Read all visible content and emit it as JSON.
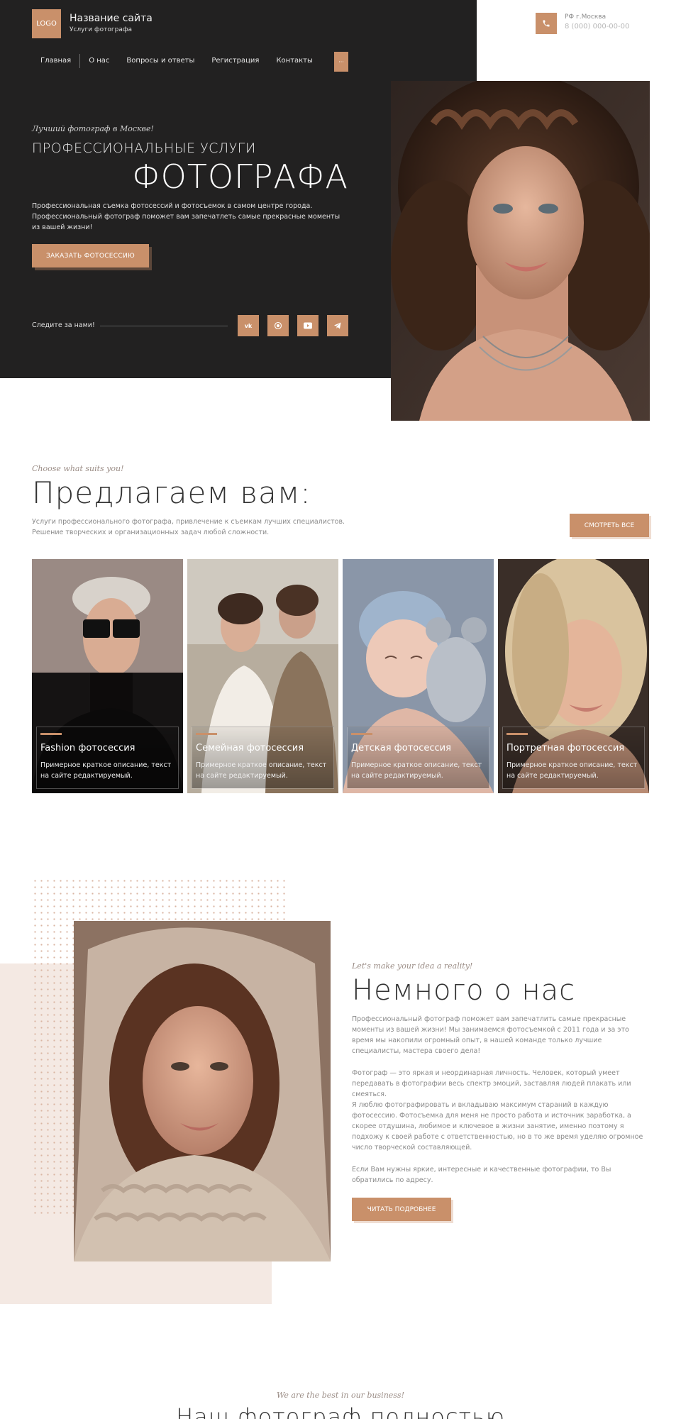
{
  "header": {
    "logo": "LOGO",
    "site_name": "Название сайта",
    "site_subtitle": "Услуги фотографа",
    "nav": [
      "Главная",
      "О нас",
      "Вопросы и ответы",
      "Регистрация",
      "Контакты"
    ],
    "contact_city": "РФ г.Москва",
    "contact_phone": "8 (000) 000-00-00"
  },
  "hero": {
    "tagline": "Лучший фотограф в Москве!",
    "title_line1": "ПРОФЕССИОНАЛЬНЫЕ УСЛУГИ",
    "title_line2": "ФОТОГРАФА",
    "description": "Профессиональная съемка фотосессий и фотосъемок в самом центре города. Профессиональный фотограф поможет вам запечатлеть самые прекрасные моменты из вашей жизни!",
    "cta": "ЗАКАЗАТЬ ФОТОСЕССИЮ",
    "follow_label": "Следите за нами!",
    "social": [
      "vk-icon",
      "whatsapp-icon",
      "youtube-icon",
      "telegram-icon"
    ]
  },
  "offers": {
    "tagline": "Choose what suits you!",
    "title": "Предлагаем вам:",
    "description": "Услуги профессионального фотографа, привлечение к съемкам лучших специалистов. Решение творческих и организационных задач любой сложности.",
    "view_all": "СМОТРЕТЬ ВСЕ",
    "cards": [
      {
        "title": "Fashion фотосессия",
        "desc": "Примерное краткое описание, текст на сайте редактируемый."
      },
      {
        "title": "Семейная фотосессия",
        "desc": "Примерное краткое описание, текст на сайте редактируемый."
      },
      {
        "title": "Детская фотосессия",
        "desc": "Примерное краткое описание, текст на сайте редактируемый."
      },
      {
        "title": "Портретная фотосессия",
        "desc": "Примерное краткое описание, текст на сайте редактируемый."
      }
    ]
  },
  "about": {
    "tagline": "Let's make your idea a reality!",
    "title": "Немного о нас",
    "paragraphs": [
      "Профессиональный фотограф поможет вам запечатлить самые прекрасные моменты из вашей жизни! Мы занимаемся фотосъемкой с 2011 года и за это время мы накопили огромный опыт, в нашей команде только лучшие специалисты, мастера своего дела!",
      "Фотограф — это яркая и неординарная личность. Человек, который умеет передавать в фотографии весь спектр эмоций, заставляя людей плакать или смеяться.",
      "Я люблю фотографировать и вкладываю максимум стараний в каждую фотосессию. Фотосъемка для меня не просто работа и источник заработка, а скорее отдушина, любимое и ключевое в жизни занятие, именно поэтому я подхожу к своей работе с ответственностью, но в то же время уделяю огромное число творческой составляющей.",
      "Если Вам нужны яркие, интересные и качественные фотографии, то Вы обратились по адресу."
    ],
    "cta": "ЧИТАТЬ ПОДРОБНЕЕ"
  },
  "next": {
    "tagline": "We are the best in our business!",
    "title": "Наш фотограф полностью"
  },
  "colors": {
    "accent": "#c9906a",
    "dark": "#222121",
    "blush": "#f4e9e3"
  }
}
